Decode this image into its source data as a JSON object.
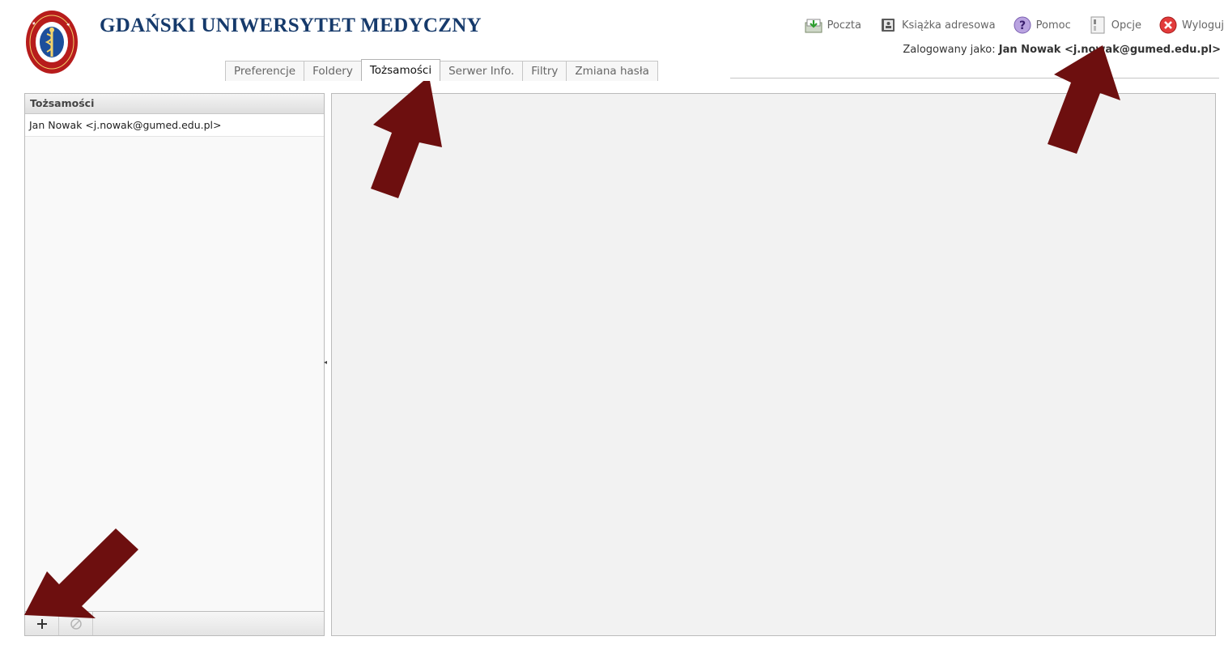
{
  "header": {
    "brand": "GDAŃSKI UNIWERSYTET MEDYCZNY",
    "logo_ring_text": "GDANSKI UNIWERSYTET MEDYCZNY",
    "nav": [
      {
        "label": "Poczta",
        "icon": "mail-inbox-icon"
      },
      {
        "label": "Książka adresowa",
        "icon": "address-book-icon"
      },
      {
        "label": "Pomoc",
        "icon": "help-icon"
      },
      {
        "label": "Opcje",
        "icon": "options-icon"
      },
      {
        "label": "Wyloguj",
        "icon": "logout-icon"
      }
    ],
    "logged_prefix": "Zalogowany jako:",
    "logged_user": "Jan Nowak <j.nowak@gumed.edu.pl>"
  },
  "tabs": [
    {
      "label": "Preferencje",
      "active": false
    },
    {
      "label": "Foldery",
      "active": false
    },
    {
      "label": "Tożsamości",
      "active": true
    },
    {
      "label": "Serwer Info.",
      "active": false
    },
    {
      "label": "Filtry",
      "active": false
    },
    {
      "label": "Zmiana hasła",
      "active": false
    }
  ],
  "identities": {
    "title": "Tożsamości",
    "items": [
      {
        "label": "Jan Nowak <j.nowak@gumed.edu.pl>"
      }
    ],
    "footer": {
      "add_icon": "plus-icon",
      "delete_icon": "delete-disabled-icon"
    }
  },
  "colors": {
    "brand": "#163a6b",
    "annotation_arrow": "#6d0f0f",
    "panel_bg": "#f2f2f2"
  }
}
